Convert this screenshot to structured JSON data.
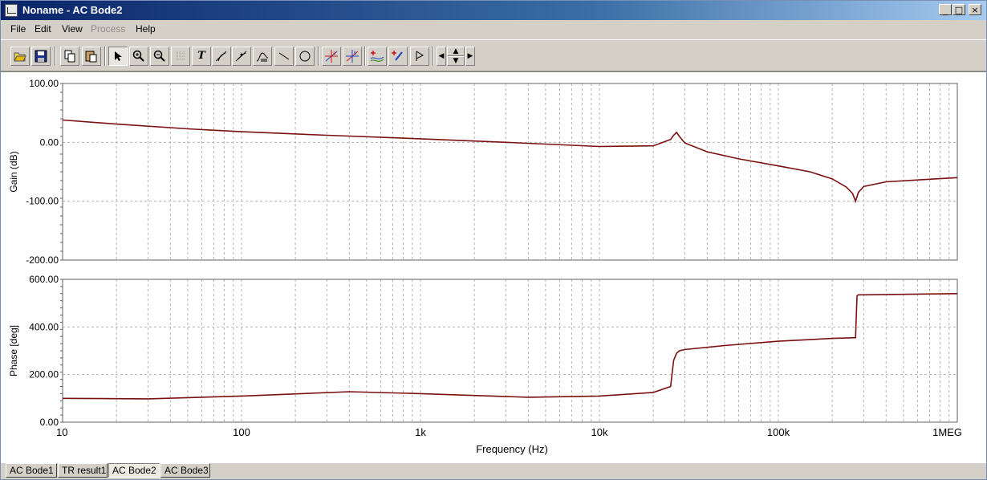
{
  "window": {
    "title": "Noname - AC Bode2",
    "min_glyph": "_",
    "max_glyph": "□",
    "close_glyph": "×"
  },
  "menu": [
    {
      "label": "File",
      "enabled": true
    },
    {
      "label": "Edit",
      "enabled": true
    },
    {
      "label": "View",
      "enabled": true
    },
    {
      "label": "Process",
      "enabled": false
    },
    {
      "label": "Help",
      "enabled": true
    }
  ],
  "toolbar": {
    "icons": [
      "open-icon",
      "save-icon",
      "copy-icon",
      "paste-icon",
      "pointer-icon",
      "zoom-in-icon",
      "zoom-out-icon",
      "grid-icon",
      "text-icon",
      "wire-icon",
      "probe-icon",
      "curve-icon",
      "line-icon",
      "circle-icon",
      "cursor-a-icon",
      "cursor-b-icon",
      "add-curve-icon",
      "marker-icon",
      "flag-icon",
      "left-arrow-icon",
      "up-arrow-icon",
      "down-arrow-icon",
      "right-arrow-icon"
    ]
  },
  "tabs": [
    {
      "label": "AC Bode1",
      "active": false
    },
    {
      "label": "TR result1",
      "active": false
    },
    {
      "label": "AC Bode2",
      "active": true
    },
    {
      "label": "AC Bode3",
      "active": false
    }
  ],
  "chart_data": [
    {
      "type": "line",
      "ylabel": "Gain (dB)",
      "ylim": [
        -200,
        100
      ],
      "yticks": [
        "100.00",
        "0.00",
        "-100.00",
        "-200.00"
      ],
      "xscale": "log",
      "xlim": [
        10,
        1000000
      ],
      "grid": true,
      "line_color": "#7a1010",
      "series": [
        {
          "x": [
            10,
            20,
            50,
            100,
            300,
            1000,
            3000,
            10000,
            20000,
            25000,
            26000,
            27000,
            28000,
            30000,
            40000,
            60000,
            100000,
            150000,
            200000,
            240000,
            260000,
            270000,
            280000,
            300000,
            400000,
            1000000
          ],
          "y": [
            38,
            31,
            23,
            18,
            12,
            6,
            0,
            -7,
            -6,
            5,
            12,
            17,
            10,
            -1,
            -16,
            -28,
            -40,
            -50,
            -62,
            -76,
            -87,
            -100,
            -85,
            -75,
            -67,
            -60
          ]
        }
      ]
    },
    {
      "type": "line",
      "xlabel": "Frequency (Hz)",
      "ylabel": "Phase [deg]",
      "ylim": [
        0,
        600
      ],
      "yticks": [
        "600.00",
        "400.00",
        "200.00",
        "0.00"
      ],
      "xscale": "log",
      "xlim": [
        10,
        1000000
      ],
      "xticks": [
        "10",
        "100",
        "1k",
        "10k",
        "100k",
        "1MEG"
      ],
      "grid": true,
      "line_color": "#7a1010",
      "series": [
        {
          "x": [
            10,
            30,
            100,
            400,
            1000,
            4000,
            10000,
            20000,
            25000,
            26000,
            27000,
            28000,
            30000,
            50000,
            100000,
            200000,
            270000,
            275000,
            280000,
            300000,
            1000000
          ],
          "y": [
            100,
            98,
            110,
            128,
            120,
            105,
            110,
            125,
            150,
            260,
            290,
            300,
            305,
            322,
            340,
            352,
            355,
            530,
            535,
            535,
            540
          ]
        }
      ]
    }
  ]
}
